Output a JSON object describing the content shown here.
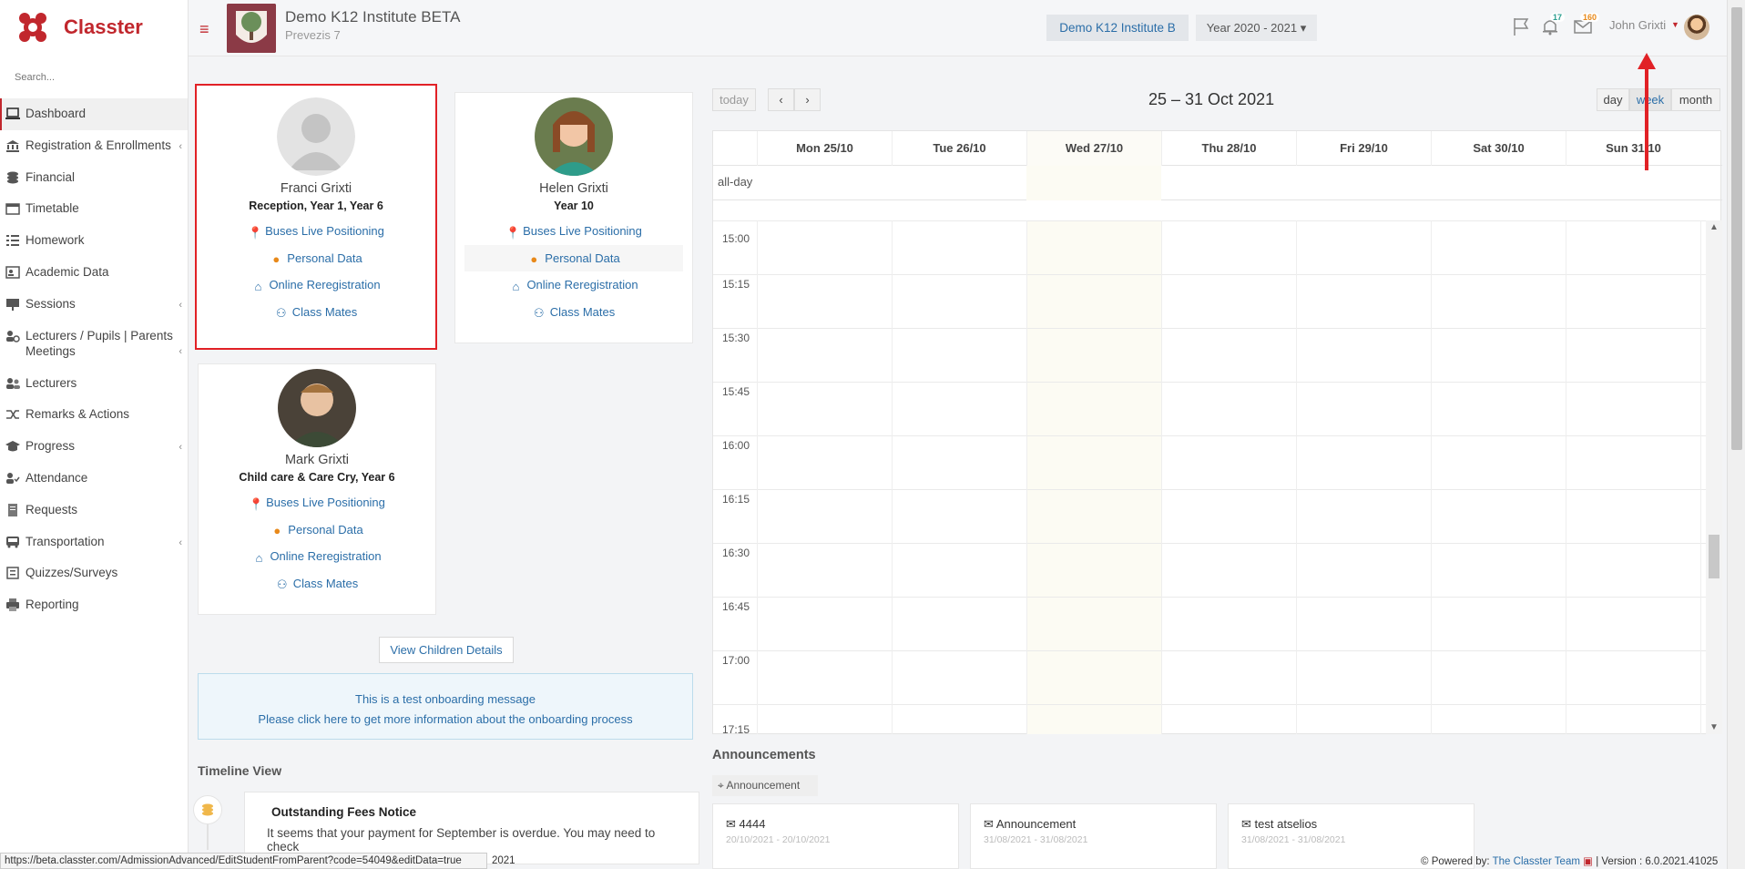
{
  "app": {
    "name": "Classter",
    "search_placeholder": "Search..."
  },
  "sidebar": {
    "items": [
      {
        "label": "Dashboard",
        "icon": "laptop-icon",
        "active": true
      },
      {
        "label": "Registration & Enrollments",
        "icon": "bank-icon",
        "chevron": true
      },
      {
        "label": "Financial",
        "icon": "coins-icon"
      },
      {
        "label": "Timetable",
        "icon": "calendar-icon"
      },
      {
        "label": "Homework",
        "icon": "list-icon"
      },
      {
        "label": "Academic Data",
        "icon": "person-card-icon"
      },
      {
        "label": "Sessions",
        "icon": "presentation-icon",
        "chevron": true
      },
      {
        "label": "Lecturers / Pupils | Parents Meetings",
        "icon": "users-meeting-icon",
        "chevron": true
      },
      {
        "label": "Lecturers",
        "icon": "users-icon"
      },
      {
        "label": "Remarks & Actions",
        "icon": "shuffle-icon"
      },
      {
        "label": "Progress",
        "icon": "graduation-cap-icon",
        "chevron": true
      },
      {
        "label": "Attendance",
        "icon": "person-check-icon"
      },
      {
        "label": "Requests",
        "icon": "document-icon"
      },
      {
        "label": "Transportation",
        "icon": "bus-icon",
        "chevron": true
      },
      {
        "label": "Quizzes/Surveys",
        "icon": "quiz-icon"
      },
      {
        "label": "Reporting",
        "icon": "printer-icon"
      }
    ]
  },
  "header": {
    "institute_title": "Demo K12 Institute BETA",
    "institute_subtitle": "Prevezis 7",
    "institute_button": "Demo K12 Institute B",
    "year_selector": "Year 2020 - 2021",
    "notifications_count": "17",
    "messages_count": "160",
    "user_name": "John Grixti"
  },
  "children": [
    {
      "name": "Franci Grixti",
      "class": "Reception, Year 1, Year 6",
      "links": [
        "Buses Live Positioning",
        "Personal Data",
        "Online Reregistration",
        "Class Mates"
      ]
    },
    {
      "name": "Helen Grixti",
      "class": "Year 10",
      "links": [
        "Buses Live Positioning",
        "Personal Data",
        "Online Reregistration",
        "Class Mates"
      ]
    },
    {
      "name": "Mark Grixti",
      "class": "Child care & Care Cry, Year 6",
      "links": [
        "Buses Live Positioning",
        "Personal Data",
        "Online Reregistration",
        "Class Mates"
      ]
    }
  ],
  "view_children_details": "View Children Details",
  "onboarding": {
    "line1": "This is a test onboarding message",
    "line2": "Please click here to get more information about the onboarding process"
  },
  "timeline": {
    "title": "Timeline View",
    "card_title": "Outstanding Fees Notice",
    "card_text": "It seems that your payment for September is overdue. You may need to check"
  },
  "calendar": {
    "today": "today",
    "prev": "‹",
    "next": "›",
    "title": "25 – 31 Oct 2021",
    "views": [
      "day",
      "week",
      "month"
    ],
    "days": [
      "Mon 25/10",
      "Tue 26/10",
      "Wed 27/10",
      "Thu 28/10",
      "Fri 29/10",
      "Sat 30/10",
      "Sun 31/10"
    ],
    "allday": "all-day",
    "times": [
      "15:00",
      "15:15",
      "15:30",
      "15:45",
      "16:00",
      "16:15",
      "16:30",
      "16:45",
      "17:00",
      "17:15"
    ]
  },
  "announcements": {
    "title": "Announcements",
    "tag": "Announcement",
    "cards": [
      {
        "title": "4444",
        "date": "20/10/2021 - 20/10/2021"
      },
      {
        "title": "Announcement",
        "date": "31/08/2021 - 31/08/2021"
      },
      {
        "title": "test atselios",
        "date": "31/08/2021 - 31/08/2021"
      }
    ]
  },
  "status_url": "https://beta.classter.com/AdmissionAdvanced/EditStudentFromParent?code=54049&editData=true",
  "status_year": "2021",
  "footer": {
    "powered": "Powered by:",
    "team": "The Classter Team",
    "version": "| Version : 6.0.2021.41025"
  },
  "colors": {
    "brand": "#c1272d",
    "link": "#2b6ea8",
    "highlight": "#e12126"
  }
}
